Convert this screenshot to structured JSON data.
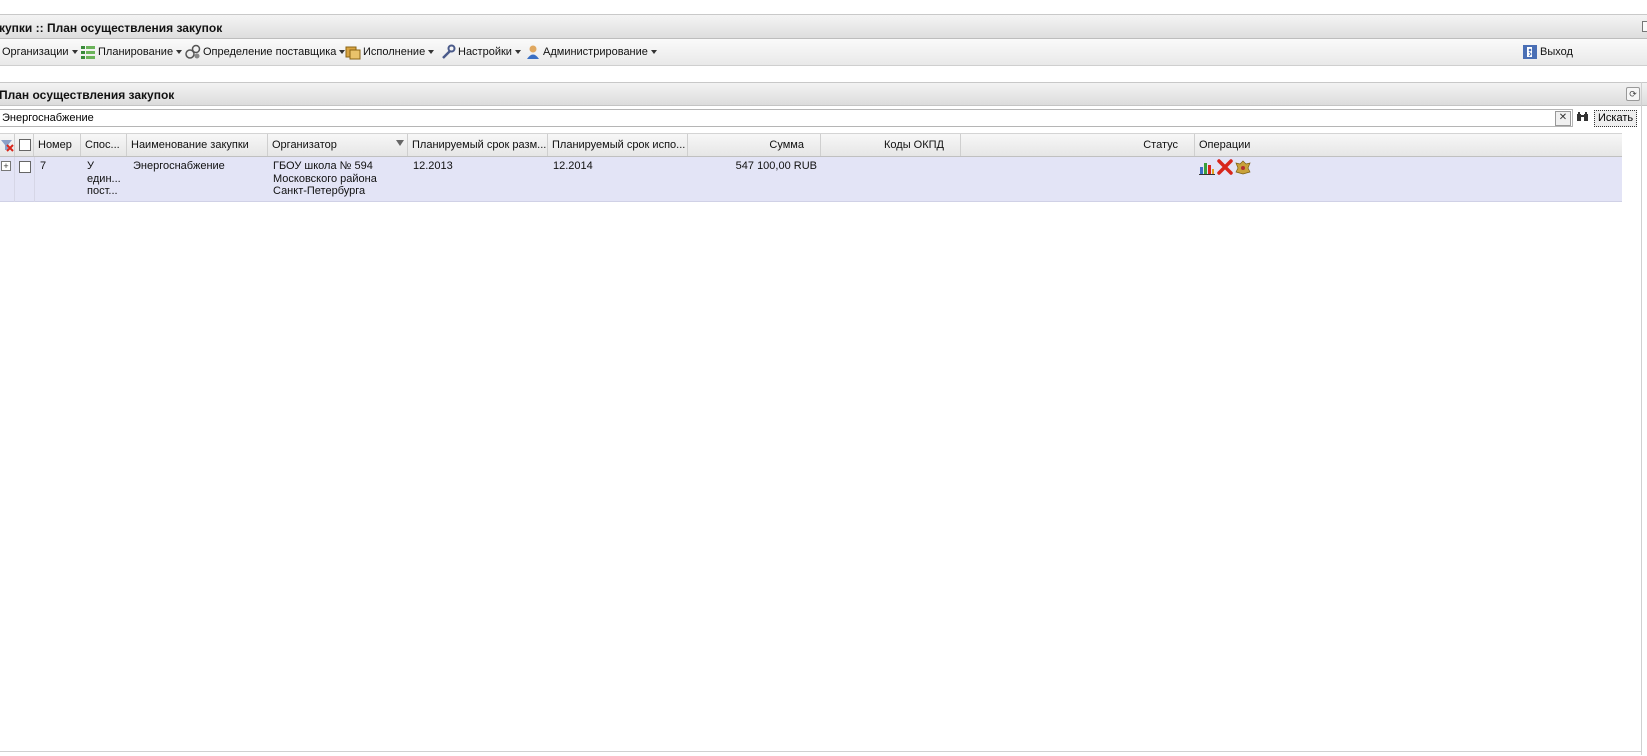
{
  "window": {
    "title": "купки :: План осуществления закупок"
  },
  "menu": {
    "items": [
      {
        "label": "Организации"
      },
      {
        "label": "Планирование"
      },
      {
        "label": "Определение поставщика"
      },
      {
        "label": "Исполнение"
      },
      {
        "label": "Настройки"
      },
      {
        "label": "Администрирование"
      }
    ],
    "exit_label": "Выход"
  },
  "panel": {
    "title": "План осуществления закупок"
  },
  "search": {
    "value": "Энергоснабжение",
    "button_label": "Искать"
  },
  "grid": {
    "columns": [
      "Номер",
      "Спос...",
      "Наименование закупки",
      "Организатор",
      "Планируемый срок разм...",
      "Планируемый срок испо...",
      "Сумма",
      "Коды ОКПД",
      "Статус",
      "Операции"
    ],
    "rows": [
      {
        "number": "7",
        "method": [
          "У",
          "един...",
          "пост..."
        ],
        "name": "Энергоснабжение",
        "organizer": [
          "ГБОУ школа № 594",
          "Московского района",
          "Санкт-Петербурга"
        ],
        "placement_date": "12.2013",
        "execution_date": "12.2014",
        "sum": "547 100,00 RUB",
        "okpd": "",
        "status": ""
      }
    ]
  },
  "colors": {
    "row_highlight": "#e3e4f6",
    "delete_red": "#d8261c"
  },
  "icons": {
    "ops": [
      "chart-icon",
      "delete-icon",
      "emblem-icon"
    ],
    "menu": [
      "planning-icon",
      "supplier-icon",
      "execution-icon",
      "settings-icon",
      "admin-icon",
      "exit-icon"
    ]
  }
}
